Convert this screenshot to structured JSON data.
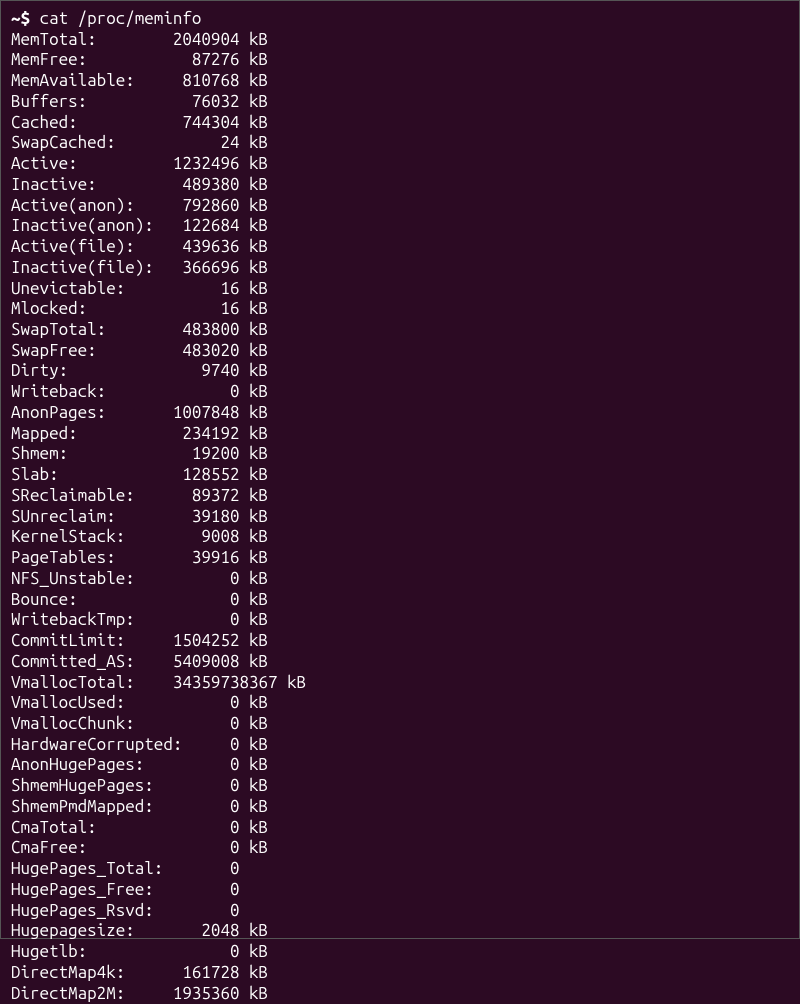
{
  "prompt": {
    "symbol": "~$ ",
    "command": "cat /proc/meminfo"
  },
  "entries": [
    {
      "label": "MemTotal:",
      "value": "2040904",
      "unit": "kB"
    },
    {
      "label": "MemFree:",
      "value": "87276",
      "unit": "kB"
    },
    {
      "label": "MemAvailable:",
      "value": "810768",
      "unit": "kB"
    },
    {
      "label": "Buffers:",
      "value": "76032",
      "unit": "kB"
    },
    {
      "label": "Cached:",
      "value": "744304",
      "unit": "kB"
    },
    {
      "label": "SwapCached:",
      "value": "24",
      "unit": "kB"
    },
    {
      "label": "Active:",
      "value": "1232496",
      "unit": "kB"
    },
    {
      "label": "Inactive:",
      "value": "489380",
      "unit": "kB"
    },
    {
      "label": "Active(anon):",
      "value": "792860",
      "unit": "kB"
    },
    {
      "label": "Inactive(anon):",
      "value": "122684",
      "unit": "kB"
    },
    {
      "label": "Active(file):",
      "value": "439636",
      "unit": "kB"
    },
    {
      "label": "Inactive(file):",
      "value": "366696",
      "unit": "kB"
    },
    {
      "label": "Unevictable:",
      "value": "16",
      "unit": "kB"
    },
    {
      "label": "Mlocked:",
      "value": "16",
      "unit": "kB"
    },
    {
      "label": "SwapTotal:",
      "value": "483800",
      "unit": "kB"
    },
    {
      "label": "SwapFree:",
      "value": "483020",
      "unit": "kB"
    },
    {
      "label": "Dirty:",
      "value": "9740",
      "unit": "kB"
    },
    {
      "label": "Writeback:",
      "value": "0",
      "unit": "kB"
    },
    {
      "label": "AnonPages:",
      "value": "1007848",
      "unit": "kB"
    },
    {
      "label": "Mapped:",
      "value": "234192",
      "unit": "kB"
    },
    {
      "label": "Shmem:",
      "value": "19200",
      "unit": "kB"
    },
    {
      "label": "Slab:",
      "value": "128552",
      "unit": "kB"
    },
    {
      "label": "SReclaimable:",
      "value": "89372",
      "unit": "kB"
    },
    {
      "label": "SUnreclaim:",
      "value": "39180",
      "unit": "kB"
    },
    {
      "label": "KernelStack:",
      "value": "9008",
      "unit": "kB"
    },
    {
      "label": "PageTables:",
      "value": "39916",
      "unit": "kB"
    },
    {
      "label": "NFS_Unstable:",
      "value": "0",
      "unit": "kB"
    },
    {
      "label": "Bounce:",
      "value": "0",
      "unit": "kB"
    },
    {
      "label": "WritebackTmp:",
      "value": "0",
      "unit": "kB"
    },
    {
      "label": "CommitLimit:",
      "value": "1504252",
      "unit": "kB"
    },
    {
      "label": "Committed_AS:",
      "value": "5409008",
      "unit": "kB"
    },
    {
      "label": "VmallocTotal:",
      "value": "34359738367",
      "unit": "kB"
    },
    {
      "label": "VmallocUsed:",
      "value": "0",
      "unit": "kB"
    },
    {
      "label": "VmallocChunk:",
      "value": "0",
      "unit": "kB"
    },
    {
      "label": "HardwareCorrupted:",
      "value": "0",
      "unit": "kB"
    },
    {
      "label": "AnonHugePages:",
      "value": "0",
      "unit": "kB"
    },
    {
      "label": "ShmemHugePages:",
      "value": "0",
      "unit": "kB"
    },
    {
      "label": "ShmemPmdMapped:",
      "value": "0",
      "unit": "kB"
    },
    {
      "label": "CmaTotal:",
      "value": "0",
      "unit": "kB"
    },
    {
      "label": "CmaFree:",
      "value": "0",
      "unit": "kB"
    },
    {
      "label": "HugePages_Total:",
      "value": "0",
      "unit": ""
    },
    {
      "label": "HugePages_Free:",
      "value": "0",
      "unit": ""
    },
    {
      "label": "HugePages_Rsvd:",
      "value": "0",
      "unit": ""
    },
    {
      "label": "Hugepagesize:",
      "value": "2048",
      "unit": "kB"
    },
    {
      "label": "Hugetlb:",
      "value": "0",
      "unit": "kB"
    },
    {
      "label": "DirectMap4k:",
      "value": "161728",
      "unit": "kB"
    },
    {
      "label": "DirectMap2M:",
      "value": "1935360",
      "unit": "kB"
    }
  ],
  "format": {
    "label_width": 16,
    "value_width": 8,
    "value_width_wide": 12
  }
}
